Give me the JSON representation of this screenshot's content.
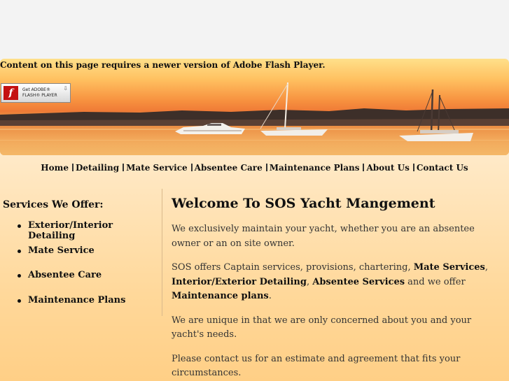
{
  "flash": {
    "message": "Content on this page requires a newer version of Adobe Flash Player.",
    "badge_line1": "Get ADOBE®",
    "badge_line2": "FLASH® PLAYER",
    "logo_letter": "f"
  },
  "nav": {
    "items": [
      "Home",
      "Detailing",
      "Mate Service",
      "Absentee Care",
      "Maintenance Plans",
      "About Us",
      "Contact Us"
    ]
  },
  "sidebar": {
    "heading": "Services We Offer:",
    "items": [
      "Exterior/Interior Detailing",
      "Mate Service",
      "Absentee Care",
      "Maintenance Plans"
    ]
  },
  "main": {
    "title": "Welcome To SOS Yacht Mangement",
    "p1": "We exclusively maintain your yacht, whether you are an absentee owner or an on site owner.",
    "p2": {
      "t1": "SOS offers Captain services, provisions, chartering, ",
      "b1": "Mate Services",
      "t2": ", ",
      "b2": "Interior/Exterior Detailing",
      "t3": ", ",
      "b3": "Absentee Services",
      "t4": " and we offer ",
      "b4": "Maintenance plans",
      "t5": "."
    },
    "p3": "We are unique in that we are only concerned about you and your yacht's needs.",
    "p4": "Please contact us for an estimate and agreement that fits your circumstances."
  },
  "colors": {
    "page_background": "#f3f3f3",
    "content_background": "#ffdfa8",
    "sunset_orange": "#f08a3c",
    "text": "#111111"
  }
}
